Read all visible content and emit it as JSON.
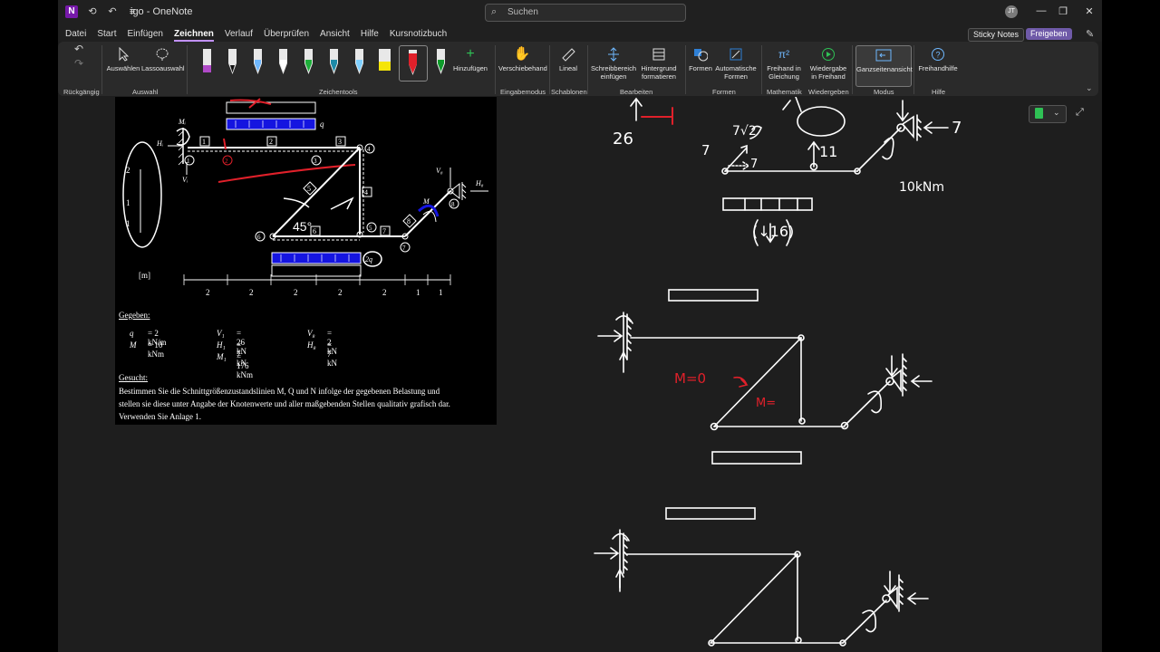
{
  "titlebar": {
    "app_title": "igo - OneNote",
    "search_placeholder": "Suchen",
    "avatar_initials": "JT"
  },
  "menu": [
    "Datei",
    "Start",
    "Einfügen",
    "Zeichnen",
    "Verlauf",
    "Überprüfen",
    "Ansicht",
    "Hilfe",
    "Kursnotizbuch"
  ],
  "menu_active": "Zeichnen",
  "sticky_notes": "Sticky Notes",
  "share": "Freigeben",
  "ribbon": {
    "undo_group": "Rückgängig",
    "select": "Auswählen",
    "lasso": "Lassoauswahl",
    "select_group": "Auswahl",
    "add": "Hinzufügen",
    "drawtools_group": "Zeichentools",
    "pan": "Verschiebehand",
    "input_group": "Eingabemodus",
    "ruler": "Lineal",
    "templates_group": "Schablonen",
    "write_area_1": "Schreibbereich",
    "write_area_2": "einfügen",
    "bg_1": "Hintergrund",
    "bg_2": "formatieren",
    "edit_group": "Bearbeiten",
    "shapes": "Formen",
    "auto_shapes_1": "Automatische",
    "auto_shapes_2": "Formen",
    "shapes_group": "Formen",
    "ink_eq_1": "Freihand in",
    "ink_eq_2": "Gleichung",
    "math_group": "Mathematik",
    "replay_1": "Wiedergabe",
    "replay_2": "in Freihand",
    "replay_group": "Wiedergeben",
    "fullpage": "Ganzseitenansicht",
    "mode_group": "Modus",
    "inkhelp": "Freihandhilfe",
    "help_group": "Hilfe"
  },
  "colors": {
    "accent": "#c191ff",
    "load_blue": "#1515e0",
    "ink_red": "#e0202a"
  },
  "problem": {
    "unit": "[m]",
    "dims": [
      "2",
      "2",
      "2",
      "2",
      "2",
      "1",
      "1"
    ],
    "labels": {
      "q": "q",
      "q2": "2q",
      "M": "M",
      "Mi": "Mᵢ",
      "Hi": "Hᵢ",
      "Vi": "Vᵢ",
      "V8": "V₈",
      "H8": "H₈"
    },
    "given_title": "Gegeben:",
    "given": [
      [
        "q",
        "= 2 kN/m",
        "V₁",
        "= 26 kN",
        "V₈",
        "= 2 kN"
      ],
      [
        "M",
        "= 10 kNm",
        "H₁",
        "= 7 kN",
        "H₈",
        "= 7 kN"
      ],
      [
        "",
        "",
        "M₁",
        "= 176 kNm",
        "",
        ""
      ]
    ],
    "sought_title": "Gesucht:",
    "sought_lines": [
      "Bestimmen Sie die Schnittgrößenzustandslinien M, Q und N infolge der gegebenen Belastung und",
      "stellen sie diese unter Angabe der Knotenwerte und aller maßgebenden Stellen qualitativ grafisch dar.",
      "Verwenden Sie Anlage 1."
    ]
  },
  "handwriting": {
    "n26": "26",
    "n7a": "7",
    "n7b": "7",
    "n7c": "7",
    "n11": "11",
    "n16": "(↓16)",
    "sqrt2": "7√2",
    "m10": "10kNm",
    "meq0": "M=0",
    "meq": "M="
  }
}
